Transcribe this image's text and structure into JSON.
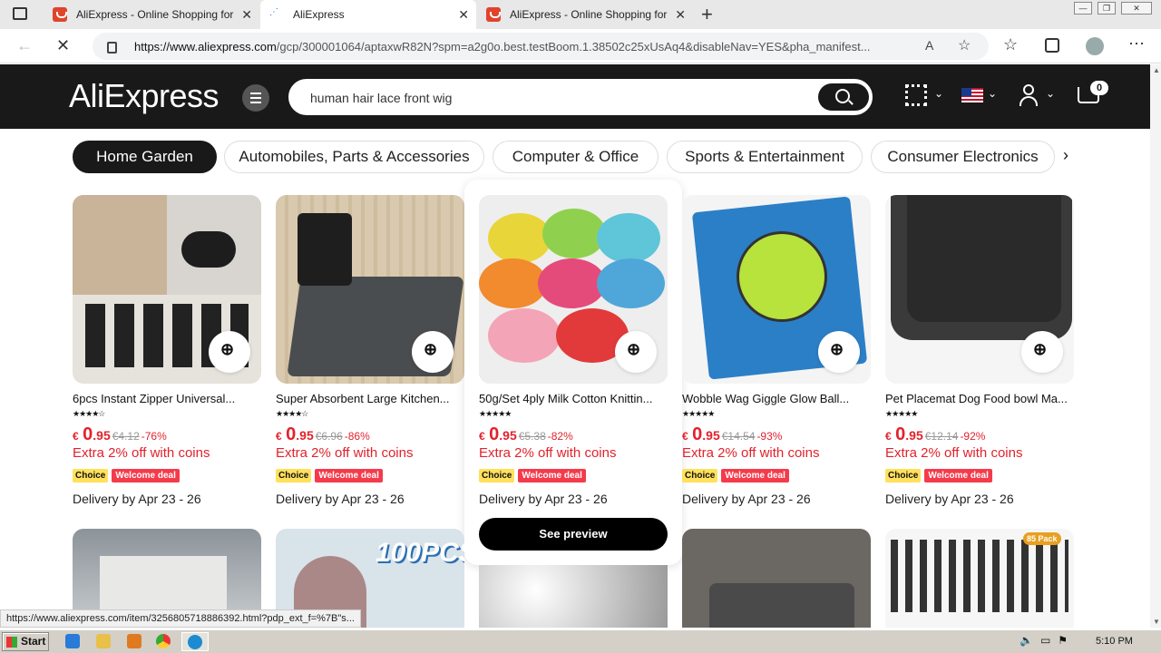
{
  "browser": {
    "tabs": [
      {
        "title": "AliExpress - Online Shopping for",
        "active": false
      },
      {
        "title": "AliExpress",
        "active": true
      },
      {
        "title": "AliExpress - Online Shopping for",
        "active": false
      }
    ],
    "new_tab_label": "+",
    "url_domain": "https://www.aliexpress.com",
    "url_rest": "/gcp/300001064/aptaxwR82N?spm=a2g0o.best.testBoom.1.38502c25xUsAq4&disableNav=YES&pha_manifest..."
  },
  "header": {
    "logo": "AliExpress",
    "search_value": "human hair lace front wig",
    "cart_count": "0"
  },
  "categories": [
    "Home Garden",
    "Automobiles, Parts & Accessories",
    "Computer & Office",
    "Sports & Entertainment",
    "Consumer Electronics"
  ],
  "products": [
    {
      "title": "6pcs Instant Zipper Universal...",
      "stars": "★★★★☆",
      "currency": "€",
      "price_int": "0",
      "price_dec": ".95",
      "orig": "€4.12",
      "disc": "-76%",
      "extra": "Extra 2% off with coins",
      "badge1": "Choice",
      "badge2": "Welcome deal",
      "delivery": "Delivery by Apr 23 - 26"
    },
    {
      "title": "Super Absorbent Large Kitchen...",
      "stars": "★★★★☆",
      "currency": "€",
      "price_int": "0",
      "price_dec": ".95",
      "orig": "€6.96",
      "disc": "-86%",
      "extra": "Extra 2% off with coins",
      "badge1": "Choice",
      "badge2": "Welcome deal",
      "delivery": "Delivery by Apr 23 - 26"
    },
    {
      "title": "50g/Set 4ply Milk Cotton Knittin...",
      "stars": "★★★★★",
      "currency": "€",
      "price_int": "0",
      "price_dec": ".95",
      "orig": "€5.38",
      "disc": "-82%",
      "extra": "Extra 2% off with coins",
      "badge1": "Choice",
      "badge2": "Welcome deal",
      "delivery": "Delivery by Apr 23 - 26"
    },
    {
      "title": "Wobble Wag Giggle Glow Ball...",
      "stars": "★★★★★",
      "currency": "€",
      "price_int": "0",
      "price_dec": ".95",
      "orig": "€14.54",
      "disc": "-93%",
      "extra": "Extra 2% off with coins",
      "badge1": "Choice",
      "badge2": "Welcome deal",
      "delivery": "Delivery by Apr 23 - 26"
    },
    {
      "title": "Pet Placemat Dog Food bowl Ma...",
      "stars": "★★★★★",
      "currency": "€",
      "price_int": "0",
      "price_dec": ".95",
      "orig": "€12.14",
      "disc": "-92%",
      "extra": "Extra 2% off with coins",
      "badge1": "Choice",
      "badge2": "Welcome deal",
      "delivery": "Delivery by Apr 23 - 26"
    }
  ],
  "see_preview": "See preview",
  "row2_label": "100PCS",
  "row2_label2": "85 Pack",
  "status_url": "https://www.aliexpress.com/item/3256805718886392.html?pdp_ext_f=%7B\"s...",
  "taskbar": {
    "start": "Start",
    "clock": "5:10 PM"
  },
  "colors": {
    "accent": "#e2222c",
    "header_bg": "#191919",
    "choice": "#ffe15b",
    "welcome": "#f43b4b"
  }
}
